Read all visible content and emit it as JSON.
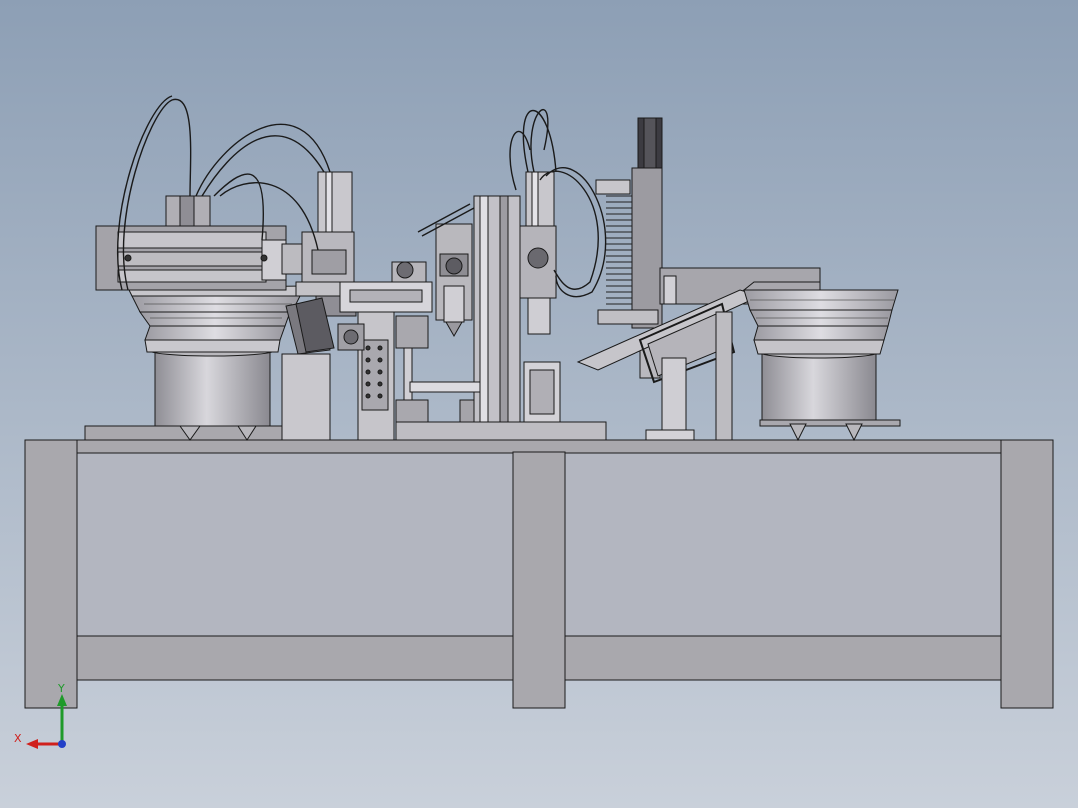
{
  "view": {
    "background_top": "#8d9fb5",
    "background_bottom": "#c9d0da",
    "model_fill": "#a9a8ad",
    "model_light": "#d4d3d8",
    "model_dark": "#6e6d73",
    "edge_color": "#1a1a1a"
  },
  "triad": {
    "x_label": "X",
    "y_label": "Y",
    "x_color": "#d0201c",
    "y_color": "#1f9a2a",
    "z_color": "#2340c8"
  }
}
